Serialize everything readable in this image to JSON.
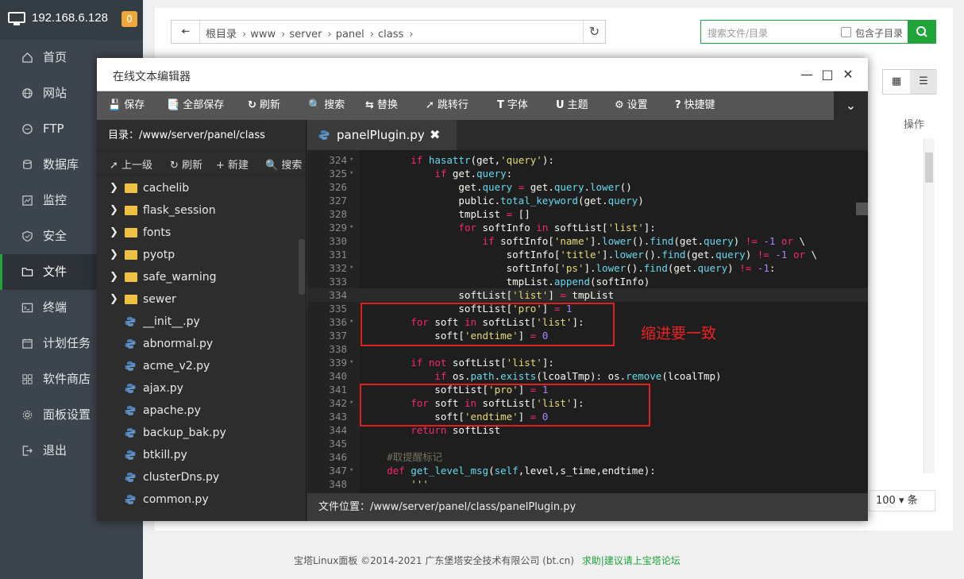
{
  "sidebar": {
    "ip": "192.168.6.128",
    "badge": "0",
    "items": [
      {
        "label": "首页",
        "icon": "home-icon"
      },
      {
        "label": "网站",
        "icon": "globe-icon"
      },
      {
        "label": "FTP",
        "icon": "ftp-icon"
      },
      {
        "label": "数据库",
        "icon": "database-icon"
      },
      {
        "label": "监控",
        "icon": "monitor-icon"
      },
      {
        "label": "安全",
        "icon": "shield-icon"
      },
      {
        "label": "文件",
        "icon": "folder-icon"
      },
      {
        "label": "终端",
        "icon": "terminal-icon"
      },
      {
        "label": "计划任务",
        "icon": "calendar-icon"
      },
      {
        "label": "软件商店",
        "icon": "grid-icon"
      },
      {
        "label": "面板设置",
        "icon": "gear-icon"
      },
      {
        "label": "退出",
        "icon": "logout-icon"
      }
    ],
    "active_index": 6
  },
  "filebar": {
    "crumbs": [
      "根目录",
      "www",
      "server",
      "panel",
      "class"
    ],
    "search_placeholder": "搜索文件/目录",
    "include_subdir": "包含子目录",
    "ops_label": "操作",
    "page_size": "100",
    "page_unit": "条"
  },
  "editor": {
    "title": "在线文本编辑器",
    "toolbar": [
      "保存",
      "全部保存",
      "刷新",
      "搜索",
      "替换",
      "跳转行",
      "字体",
      "主题",
      "设置",
      "快捷键"
    ],
    "tree": {
      "dir_label": "目录：/www/server/panel/class",
      "tools": [
        "上一级",
        "刷新",
        "新建",
        "搜索"
      ],
      "folders": [
        "cachelib",
        "flask_session",
        "fonts",
        "pyotp",
        "safe_warning",
        "sewer"
      ],
      "files": [
        "__init__.py",
        "abnormal.py",
        "acme_v2.py",
        "ajax.py",
        "apache.py",
        "backup_bak.py",
        "btkill.py",
        "clusterDns.py",
        "common.py"
      ]
    },
    "tab": "panelPlugin.py",
    "code_lines": [
      {
        "n": "324",
        "fold": true,
        "html": "        <span class='kw'>if</span> <span class='fn'>hasattr</span>(get,<span class='st'>'query'</span>):"
      },
      {
        "n": "325",
        "fold": true,
        "html": "            <span class='kw'>if</span> get.<span class='fn'>query</span>:"
      },
      {
        "n": "326",
        "fold": false,
        "html": "                get.<span class='fn'>query</span> <span class='op'>=</span> get.<span class='fn'>query</span>.<span class='fn'>lower</span>()"
      },
      {
        "n": "327",
        "fold": false,
        "html": "                public.<span class='fn'>total_keyword</span>(get.<span class='fn'>query</span>)"
      },
      {
        "n": "328",
        "fold": false,
        "html": "                tmpList <span class='op'>=</span> []"
      },
      {
        "n": "329",
        "fold": true,
        "html": "                <span class='kw'>for</span> softInfo <span class='kw'>in</span> softList[<span class='st'>'list'</span>]:"
      },
      {
        "n": "330",
        "fold": false,
        "html": "                    <span class='kw'>if</span> softInfo[<span class='st'>'name'</span>].<span class='fn'>lower</span>().<span class='fn'>find</span>(get.<span class='fn'>query</span>) <span class='op'>!=</span> <span class='nu'>-1</span> <span class='kw'>or</span> \\"
      },
      {
        "n": "331",
        "fold": false,
        "html": "                        softInfo[<span class='st'>'title'</span>].<span class='fn'>lower</span>().<span class='fn'>find</span>(get.<span class='fn'>query</span>) <span class='op'>!=</span> <span class='nu'>-1</span> <span class='kw'>or</span> \\"
      },
      {
        "n": "332",
        "fold": true,
        "html": "                        softInfo[<span class='st'>'ps'</span>].<span class='fn'>lower</span>().<span class='fn'>find</span>(get.<span class='fn'>query</span>) <span class='op'>!=</span> <span class='nu'>-1</span>:"
      },
      {
        "n": "333",
        "fold": false,
        "html": "                        tmpList.<span class='fn'>append</span>(softInfo)"
      },
      {
        "n": "334",
        "fold": false,
        "html": "                softList[<span class='st'>'list'</span>] <span class='op'>=</span> tmpList"
      },
      {
        "n": "335",
        "fold": false,
        "html": "                softList[<span class='st'>'pro'</span>] <span class='op'>=</span> <span class='nu'>1</span>"
      },
      {
        "n": "336",
        "fold": true,
        "html": "        <span class='kw'>for</span> soft <span class='kw'>in</span> softList[<span class='st'>'list'</span>]:"
      },
      {
        "n": "337",
        "fold": false,
        "html": "            soft[<span class='st'>'endtime'</span>] <span class='op'>=</span> <span class='nu'>0</span>"
      },
      {
        "n": "338",
        "fold": false,
        "html": ""
      },
      {
        "n": "339",
        "fold": true,
        "html": "        <span class='kw'>if</span> <span class='kw'>not</span> softList[<span class='st'>'list'</span>]:"
      },
      {
        "n": "340",
        "fold": false,
        "html": "            <span class='kw'>if</span> os.<span class='fn'>path</span>.<span class='fn'>exists</span>(lcoalTmp): os.<span class='fn'>remove</span>(lcoalTmp)"
      },
      {
        "n": "341",
        "fold": false,
        "html": "            softList[<span class='st'>'pro'</span>] <span class='op'>=</span> <span class='nu'>1</span>"
      },
      {
        "n": "342",
        "fold": true,
        "html": "        <span class='kw'>for</span> soft <span class='kw'>in</span> softList[<span class='st'>'list'</span>]:"
      },
      {
        "n": "343",
        "fold": false,
        "html": "            soft[<span class='st'>'endtime'</span>] <span class='op'>=</span> <span class='nu'>0</span>"
      },
      {
        "n": "344",
        "fold": false,
        "html": "        <span class='kw'>return</span> softList"
      },
      {
        "n": "345",
        "fold": false,
        "html": ""
      },
      {
        "n": "346",
        "fold": false,
        "html": "    <span class='cm'>#取提醒标记</span>"
      },
      {
        "n": "347",
        "fold": true,
        "html": "    <span class='kw'>def</span> <span class='fn'>get_level_msg</span>(<span class='fn'>self</span>,level,s_time,endtime):"
      },
      {
        "n": "348",
        "fold": false,
        "html": "        <span class='st'>'''</span>"
      }
    ],
    "annotation": "缩进要一致",
    "file_location": "文件位置：/www/server/panel/class/panelPlugin.py"
  },
  "footer": {
    "text": "宝塔Linux面板 ©2014-2021 广东堡塔安全技术有限公司 (bt.cn)",
    "link": "求助|建议请上宝塔论坛"
  },
  "colors": {
    "accent": "#20a53a",
    "annotation": "#e02020",
    "sidebar_bg": "#3c444d"
  }
}
